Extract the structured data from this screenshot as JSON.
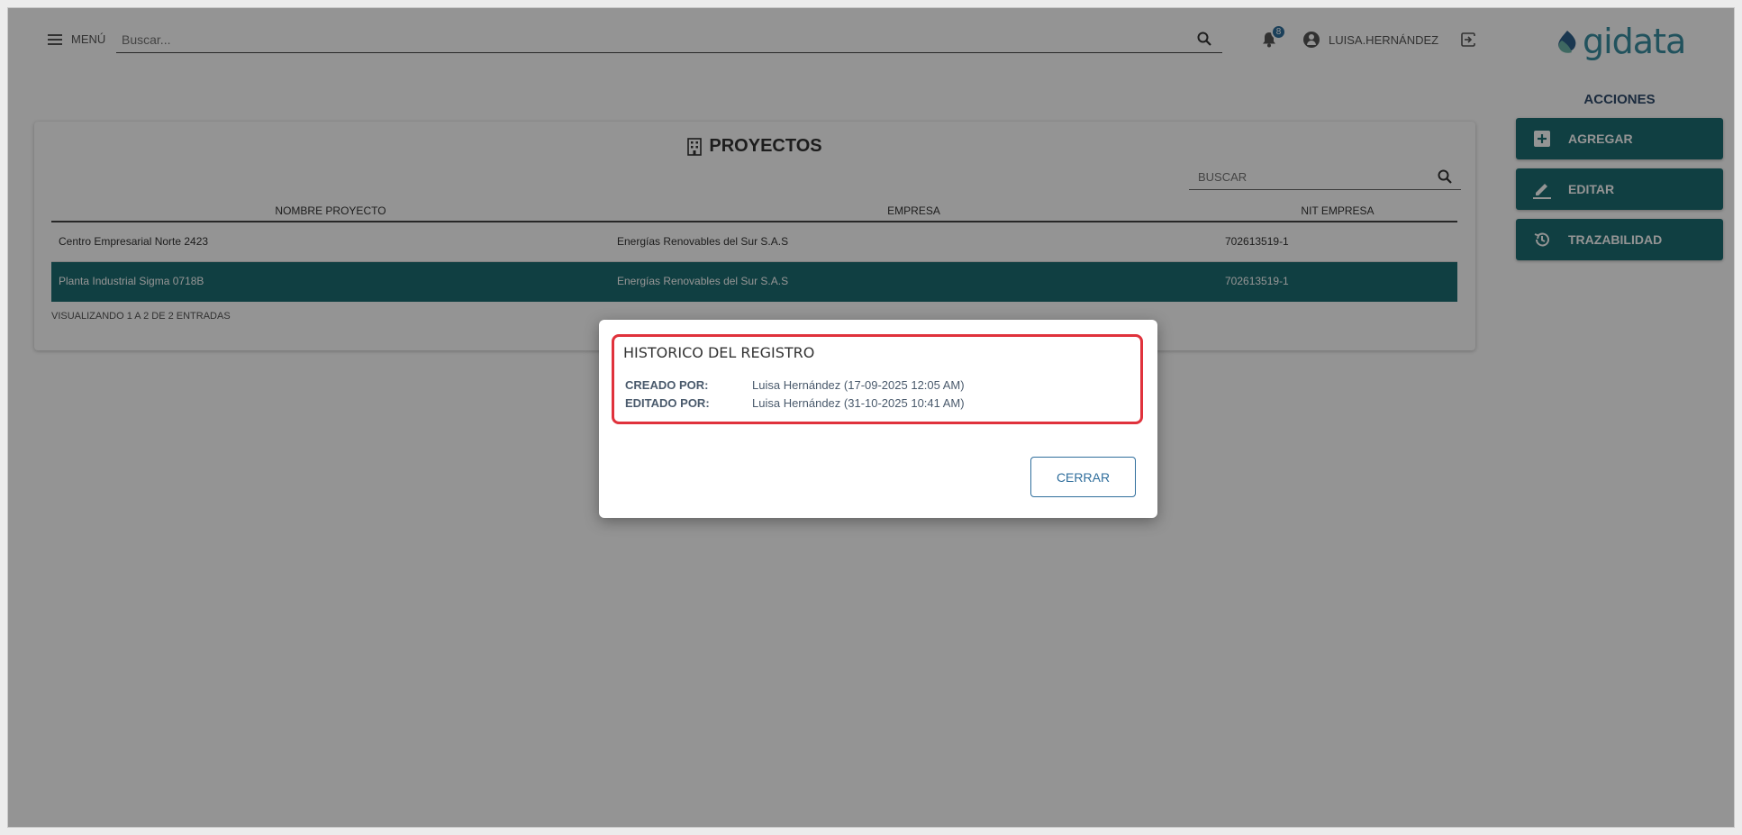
{
  "header": {
    "menu_label": "MENÚ",
    "search_placeholder": "Buscar...",
    "notifications_count": "8",
    "username": "LUISA.HERNÁNDEZ",
    "logo_text": "gidata"
  },
  "panel": {
    "title": "PROYECTOS",
    "search_placeholder": "BUSCAR",
    "columns": [
      "NOMBRE PROYECTO",
      "EMPRESA",
      "NIT EMPRESA"
    ],
    "rows": [
      {
        "name": "Centro Empresarial Norte 2423",
        "company": "Energías Renovables del Sur S.A.S",
        "nit": "702613519-1"
      },
      {
        "name": "Planta Industrial Sigma 0718B",
        "company": "Energías Renovables del Sur S.A.S",
        "nit": "702613519-1"
      }
    ],
    "entries_text": "VISUALIZANDO 1 A 2 DE 2 ENTRADAS"
  },
  "actions": {
    "title": "ACCIONES",
    "add_label": "AGREGAR",
    "edit_label": "EDITAR",
    "trace_label": "TRAZABILIDAD"
  },
  "modal": {
    "title": "HISTORICO DEL REGISTRO",
    "created_label": "CREADO POR:",
    "created_value": "Luisa Hernández (17-09-2025 12:05 AM)",
    "edited_label": "EDITADO POR:",
    "edited_value": "Luisa Hernández (31-10-2025 10:41 AM)",
    "close_label": "CERRAR"
  },
  "colors": {
    "accent": "#1c6d72",
    "primary_blue": "#2f6e9c",
    "highlight_red": "#e0323c"
  }
}
